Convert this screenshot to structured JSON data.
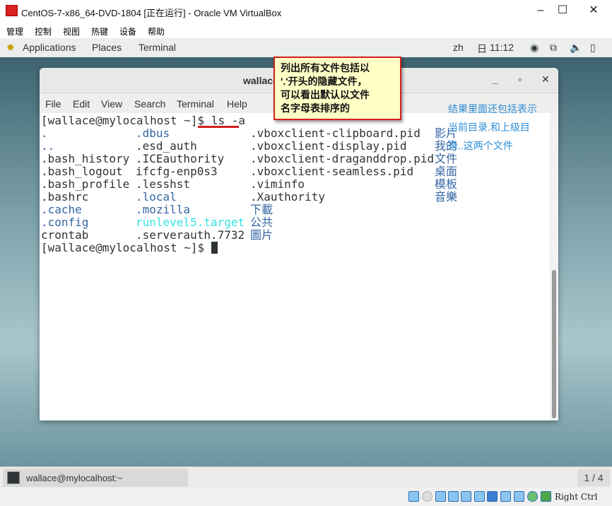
{
  "window": {
    "title": "CentOS-7-x86_64-DVD-1804 [正在运行] - Oracle VM VirtualBox",
    "minimize": "–",
    "maximize": "☐",
    "close": "✕"
  },
  "vbox_menu": [
    "管理",
    "控制",
    "视图",
    "热键",
    "设备",
    "帮助"
  ],
  "gnome": {
    "applications": "Applications",
    "places": "Places",
    "terminal": "Terminal",
    "lang": "zh",
    "day": "日",
    "time": "11:12"
  },
  "terminal": {
    "title": "wallace@mylocalhost:~",
    "menu": [
      "File",
      "Edit",
      "View",
      "Search",
      "Terminal",
      "Help"
    ],
    "prompt": "[wallace@mylocalhost ~]$ ",
    "command": "ls -a",
    "rows": [
      [
        {
          "t": ".",
          "c": "#3465a4"
        },
        {
          "t": ".dbus",
          "c": "#3465a4"
        },
        {
          "t": ".vboxclient-clipboard.pid",
          "c": "#2e3436"
        },
        {
          "t": "影片",
          "c": "#3465a4"
        }
      ],
      [
        {
          "t": "..",
          "c": "#3465a4"
        },
        {
          "t": ".esd_auth",
          "c": "#2e3436"
        },
        {
          "t": ".vboxclient-display.pid",
          "c": "#2e3436"
        },
        {
          "t": "我的",
          "c": "#3465a4"
        }
      ],
      [
        {
          "t": ".bash_history",
          "c": "#2e3436"
        },
        {
          "t": ".ICEauthority",
          "c": "#2e3436"
        },
        {
          "t": ".vboxclient-draganddrop.pid",
          "c": "#2e3436"
        },
        {
          "t": "文件",
          "c": "#3465a4"
        }
      ],
      [
        {
          "t": ".bash_logout",
          "c": "#2e3436"
        },
        {
          "t": "ifcfg-enp0s3",
          "c": "#2e3436"
        },
        {
          "t": ".vboxclient-seamless.pid",
          "c": "#2e3436"
        },
        {
          "t": "桌面",
          "c": "#3465a4"
        }
      ],
      [
        {
          "t": ".bash_profile",
          "c": "#2e3436"
        },
        {
          "t": ".lesshst",
          "c": "#2e3436"
        },
        {
          "t": ".viminfo",
          "c": "#2e3436"
        },
        {
          "t": "模板",
          "c": "#3465a4"
        }
      ],
      [
        {
          "t": ".bashrc",
          "c": "#2e3436"
        },
        {
          "t": ".local",
          "c": "#3465a4"
        },
        {
          "t": ".Xauthority",
          "c": "#2e3436"
        },
        {
          "t": "音樂",
          "c": "#3465a4"
        }
      ],
      [
        {
          "t": ".cache",
          "c": "#3465a4"
        },
        {
          "t": ".mozilla",
          "c": "#3465a4"
        },
        {
          "t": "下載",
          "c": "#3465a4"
        },
        {
          "t": "",
          "c": "#2e3436"
        }
      ],
      [
        {
          "t": ".config",
          "c": "#3465a4"
        },
        {
          "t": "runlevel5.target",
          "c": "#34e2e2"
        },
        {
          "t": "公共",
          "c": "#3465a4"
        },
        {
          "t": "",
          "c": "#2e3436"
        }
      ],
      [
        {
          "t": "crontab",
          "c": "#2e3436"
        },
        {
          "t": ".serverauth.7732",
          "c": "#2e3436"
        },
        {
          "t": "圖片",
          "c": "#3465a4"
        },
        {
          "t": "",
          "c": "#2e3436"
        }
      ]
    ]
  },
  "annotations": {
    "note_lines": [
      "列出所有文件包括以",
      "'.'开头的隐藏文件，",
      "可以看出默认以文件",
      "名字母表排序的"
    ],
    "side_lines": [
      "结果里面还包括表示",
      "当前目录.和上级目",
      "录..这两个文件"
    ]
  },
  "taskbar": {
    "task": "wallace@mylocalhost:~",
    "pager": "1 / 4"
  },
  "statusbar": {
    "host_key": "Right Ctrl"
  }
}
